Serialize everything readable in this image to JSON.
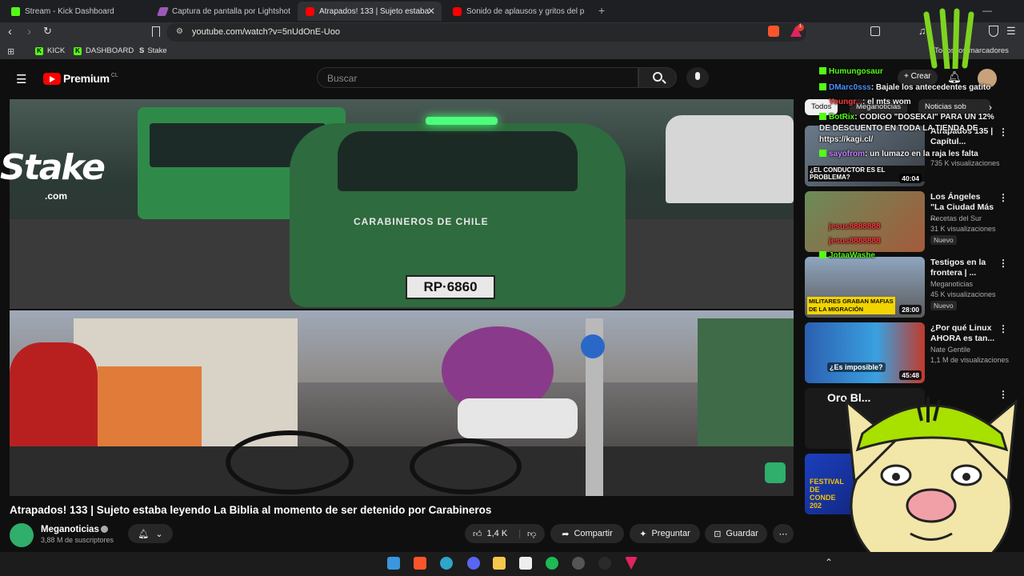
{
  "browser": {
    "tabs": [
      {
        "label": "Stream - Kick Dashboard",
        "active": false,
        "favicon": "kick-icon"
      },
      {
        "label": "Captura de pantalla por Lightshot",
        "active": false,
        "favicon": "lightshot-icon"
      },
      {
        "label": "Atrapados! 133 | Sujeto estaba",
        "active": true,
        "favicon": "youtube-icon"
      },
      {
        "label": "Sonido de aplausos y gritos del p",
        "active": false,
        "favicon": "youtube-icon"
      }
    ],
    "url": "youtube.com/watch?v=5nUdOnE-Uoo",
    "notification_count": "1",
    "bookmarks": [
      {
        "label": "KICK"
      },
      {
        "label": "DASHBOARD"
      },
      {
        "label": "Stake"
      }
    ],
    "all_bookmarks_label": "Todos los marcadores"
  },
  "youtube": {
    "logo_text": "Premium",
    "region": "CL",
    "search_placeholder": "Buscar",
    "create_label": "Crear"
  },
  "overlay": {
    "stake_logo": "Stake",
    "stake_suffix": ".com"
  },
  "video": {
    "title": "Atrapados! 133 | Sujeto estaba leyendo La Biblia al momento de ser detenido por Carabineros",
    "car_text": "CARABINEROS DE CHILE",
    "plate": "RP·6860",
    "channel": "Meganoticias",
    "subscribers": "3,88 M de suscriptores",
    "likes": "1,4 K",
    "share_label": "Compartir",
    "ask_label": "Preguntar",
    "save_label": "Guardar"
  },
  "sidebar": {
    "chips": [
      "Todos",
      "Meganoticias",
      "Noticias sob"
    ],
    "videos": [
      {
        "title": "Atrapados 135 | Capítul...",
        "channel": "",
        "views": "735 K visualizaciones",
        "duration": "40:04",
        "new": "",
        "thumb_text": "¿EL CONDUCTOR ES EL PROBLEMA?"
      },
      {
        "title": "Los Ángeles \"La Ciudad Más ...",
        "channel": "Recetas del Sur",
        "views": "31 K visualizaciones",
        "duration": "",
        "new": "Nuevo",
        "thumb_text": ""
      },
      {
        "title": "Testigos en la frontera | ...",
        "channel": "Meganoticias",
        "views": "45 K visualizaciones",
        "duration": "28:00",
        "new": "Nuevo",
        "thumb_text": "MILITARES GRABAN MAFIAS DE LA MIGRACIÓN"
      },
      {
        "title": "¿Por qué Linux AHORA es tan...",
        "channel": "Nate Gentile",
        "views": "1,1 M de visualizaciones",
        "duration": "45:48",
        "new": "",
        "thumb_text": "¿Es imposible?"
      },
      {
        "title": "Oro Bl...",
        "channel": "",
        "views": "",
        "duration": "",
        "new": "",
        "thumb_text": ""
      },
      {
        "title": "",
        "channel": "",
        "views": "",
        "duration": "",
        "new": "",
        "thumb_text": "FESTIVAL DE CONDE 202"
      }
    ]
  },
  "chat": [
    {
      "user": "Humungosaur",
      "text": "",
      "color": "#53fc18"
    },
    {
      "user": "DMarc0sss",
      "text": ": Bajale los antecedentes gatito",
      "color": "#4a90ff"
    },
    {
      "user": "Youngr...",
      "text": ": el mts wom",
      "color": "#ff3b3b"
    },
    {
      "user": "BotRix",
      "text": ": CODIGO \"DOSEKAI\" PARA UN 12% DE DESCUENTO EN TODA LA TIENDA DE https://kagi.cl/",
      "color": "#53fc18"
    },
    {
      "user": "sayofrom",
      "text": ": un lumazo en la raja les falta",
      "color": "#c77dff"
    },
    {
      "user": "jesus8888888",
      "text": "",
      "color": "#ff3b3b"
    },
    {
      "user": "jesus8888888",
      "text": "",
      "color": "#ff3b3b"
    },
    {
      "user": "JotaaWashe",
      "text": "",
      "color": "#53fc18"
    }
  ],
  "taskbar": {
    "icons": [
      "windows-start-icon",
      "brave-icon",
      "edge-icon",
      "discord-icon",
      "file-explorer-icon",
      "app-icon",
      "spotify-icon",
      "obs-icon",
      "steam-icon",
      "app2-icon"
    ]
  },
  "colors": {
    "youtube_red": "#ff0000",
    "kick_green": "#53fc18",
    "background": "#0f0f0f"
  }
}
